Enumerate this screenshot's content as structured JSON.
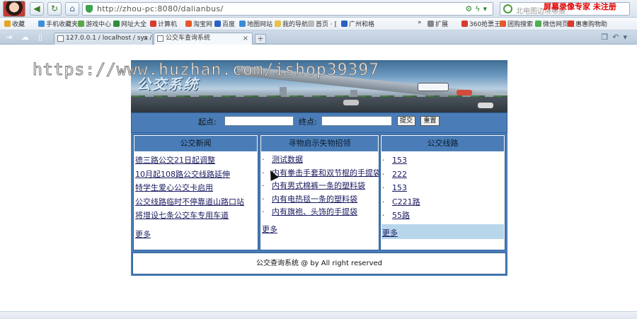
{
  "browser": {
    "url": "http://zhou-pc:8080/dalianbus/",
    "search_placeholder": "北电图边境哪报",
    "recorder_label": "屏幕录像专家  未注册",
    "bookmarks": [
      {
        "label": "收藏",
        "color": "#e5a623"
      },
      {
        "label": "手机收藏夹",
        "color": "#3c8fd8"
      },
      {
        "label": "游戏中心",
        "color": "#5aa84a"
      },
      {
        "label": "网址大全",
        "color": "#2d8f3a"
      },
      {
        "label": "计算机",
        "color": "#d83b2c"
      },
      {
        "label": "淘宝网",
        "color": "#e5582a"
      },
      {
        "label": "百度",
        "color": "#2b5fc4"
      },
      {
        "label": "地图网站",
        "color": "#3a8ad8"
      },
      {
        "label": "我的导航",
        "color": "#e6c04a"
      },
      {
        "label": "首页 · [",
        "color": "#bbbbbb"
      },
      {
        "label": "广州和格",
        "color": "#2b5fc4"
      },
      {
        "label": "扩展",
        "color": "#888888"
      },
      {
        "label": "360抢票王",
        "color": "#d83b2c"
      },
      {
        "label": "团购搜索",
        "color": "#e5582a"
      },
      {
        "label": "微信网页版",
        "color": "#4caf50"
      },
      {
        "label": "惠惠购物助",
        "color": "#d83b2c"
      }
    ],
    "tabs": [
      {
        "label": "127.0.0.1 / localhost / sys /"
      },
      {
        "label": "公交车查询系统"
      }
    ]
  },
  "watermark": "https://www.huzhan.com/ishop39397",
  "banner_title": "公交系统",
  "search": {
    "start_label": "起点:",
    "end_label": "终点:",
    "submit_label": "提交",
    "reset_label": "重置"
  },
  "news": {
    "title": "公交新闻",
    "items": [
      "德三路公交21日起调整",
      "10月起108路公交线路延伸",
      "特学生爱心公交卡启用",
      "公交线路临时不停靠道山路口站",
      "将增设七条公交车专用车道"
    ],
    "more": "更多"
  },
  "lost": {
    "title": "寻物启示失物招领",
    "items": [
      "测试数据",
      "内有拳击手套和双节棍的手提袋",
      "内有男式棉裤一条的塑料袋",
      "内有电热毯一条的塑料袋",
      "内有旗袍、头饰的手提袋"
    ],
    "more": "更多"
  },
  "routes": {
    "title": "公交线路",
    "items": [
      "153",
      "222",
      "153",
      "C221路",
      "55路"
    ],
    "more": "更多"
  },
  "footer": "公交查询系统 @ by All right reserved",
  "colors": {
    "panel_blue": "#4a7db7",
    "more_highlight": "#b8d6ea",
    "link": "#1a1a60"
  }
}
